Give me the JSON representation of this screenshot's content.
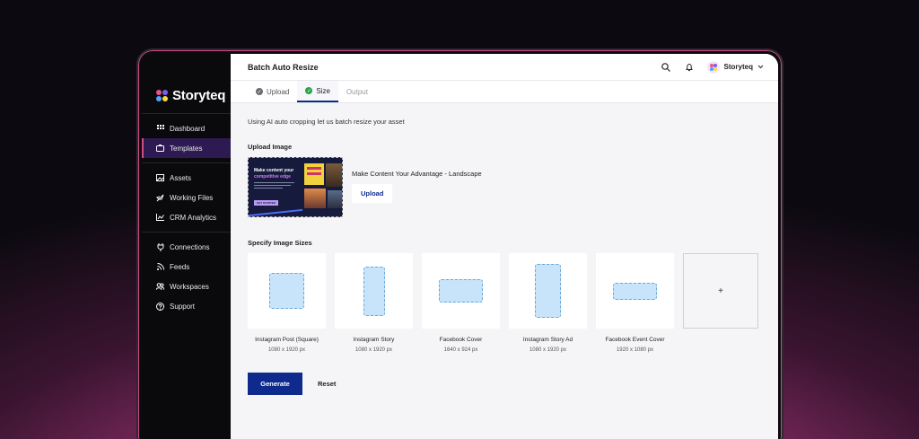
{
  "brand": {
    "name": "Storyteq",
    "colors": {
      "accent": "#d14b86",
      "primary": "#0d2a8c",
      "active_nav": "#2e1a52"
    }
  },
  "sidebar": {
    "groups": [
      [
        {
          "label": "Dashboard",
          "icon": "grid-icon"
        },
        {
          "label": "Templates",
          "icon": "templates-icon",
          "active": true
        }
      ],
      [
        {
          "label": "Assets",
          "icon": "image-icon"
        },
        {
          "label": "Working Files",
          "icon": "rocket-icon"
        },
        {
          "label": "CRM Analytics",
          "icon": "chart-icon"
        }
      ],
      [
        {
          "label": "Connections",
          "icon": "plug-icon"
        },
        {
          "label": "Feeds",
          "icon": "feed-icon"
        },
        {
          "label": "Workspaces",
          "icon": "users-icon"
        },
        {
          "label": "Support",
          "icon": "help-icon"
        }
      ]
    ]
  },
  "header": {
    "title": "Batch Auto Resize",
    "user_name": "Storyteq"
  },
  "tabs": [
    {
      "label": "Upload",
      "state": "done"
    },
    {
      "label": "Size",
      "state": "active"
    },
    {
      "label": "Output",
      "state": "disabled"
    }
  ],
  "main": {
    "intro": "Using AI auto cropping let us batch resize your asset",
    "upload_section_label": "Upload Image",
    "thumbnail": {
      "headline_1": "Make content your",
      "headline_2": "competitive edge",
      "cta": "GET STARTED"
    },
    "upload_name": "Make Content Your Advantage - Landscape",
    "upload_button": "Upload",
    "sizes_section_label": "Specify Image Sizes",
    "sizes": [
      {
        "name": "Instagram Post (Square)",
        "dims": "1080 x 1920 px"
      },
      {
        "name": "Instagram Story",
        "dims": "1080 x 1920 px"
      },
      {
        "name": "Facebook Cover",
        "dims": "1640 x 924 px"
      },
      {
        "name": "Instagram Story Ad",
        "dims": "1080 x 1920 px"
      },
      {
        "name": "Facebook Event Cover",
        "dims": "1920 x 1080 px"
      }
    ],
    "add_size_label": "+",
    "generate_button": "Generate",
    "reset_button": "Reset"
  }
}
